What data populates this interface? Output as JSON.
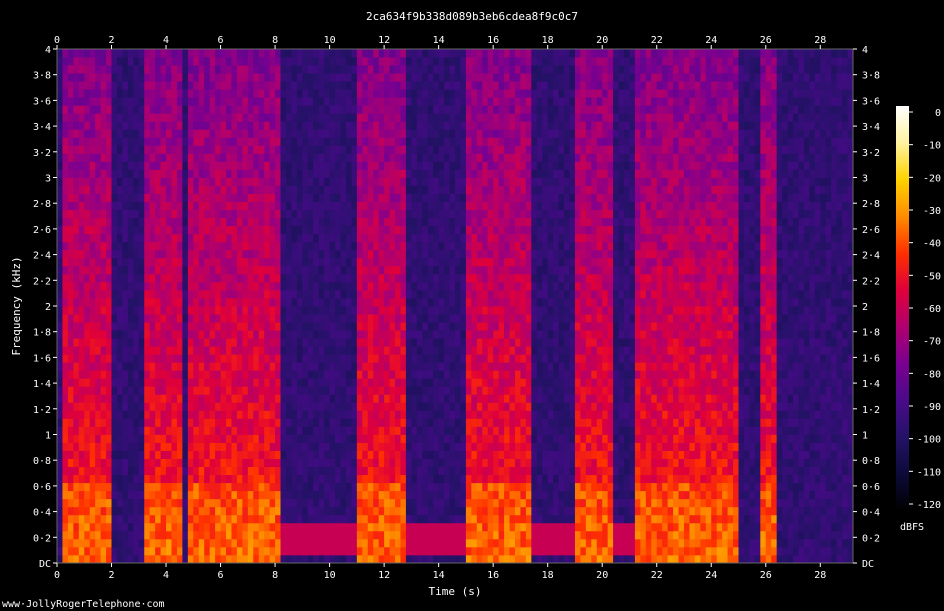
{
  "chart_data": {
    "type": "heatmap",
    "title": "2ca634f9b338d089b3eb6cdea8f9c0c7",
    "xlabel": "Time (s)",
    "ylabel": "Frequency (kHz)",
    "xlim": [
      0,
      29.2
    ],
    "ylim": [
      0,
      4
    ],
    "x_ticks": [
      "0",
      "2",
      "4",
      "6",
      "8",
      "10",
      "12",
      "14",
      "16",
      "18",
      "20",
      "22",
      "24",
      "26",
      "28"
    ],
    "x_tick_values": [
      0,
      2,
      4,
      6,
      8,
      10,
      12,
      14,
      16,
      18,
      20,
      22,
      24,
      26,
      28
    ],
    "y_ticks": [
      "DC",
      "0·2",
      "0·4",
      "0·6",
      "0·8",
      "1",
      "1·2",
      "1·4",
      "1·6",
      "1·8",
      "2",
      "2·2",
      "2·4",
      "2·6",
      "2·8",
      "3",
      "3·2",
      "3·4",
      "3·6",
      "3·8",
      "4"
    ],
    "y_tick_values": [
      0,
      0.2,
      0.4,
      0.6,
      0.8,
      1.0,
      1.2,
      1.4,
      1.6,
      1.8,
      2.0,
      2.2,
      2.4,
      2.6,
      2.8,
      3.0,
      3.2,
      3.4,
      3.6,
      3.8,
      4.0
    ],
    "colorbar": {
      "label": "dBFS",
      "ticks": [
        "0",
        "-10",
        "-20",
        "-30",
        "-40",
        "-50",
        "-60",
        "-70",
        "-80",
        "-90",
        "-100",
        "-110",
        "-120"
      ],
      "tick_values": [
        0,
        -10,
        -20,
        -30,
        -40,
        -50,
        -60,
        -70,
        -80,
        -90,
        -100,
        -110,
        -120
      ],
      "range": [
        -120,
        0
      ],
      "colormap": [
        "#ffffff",
        "#fff3a0",
        "#ffd200",
        "#ff8c00",
        "#ff3000",
        "#e0003a",
        "#b0006e",
        "#7a0090",
        "#4a0a8a",
        "#251268",
        "#0d0a3a",
        "#000000"
      ]
    },
    "speech_segments_s": [
      [
        0.2,
        1.9
      ],
      [
        3.2,
        4.6
      ],
      [
        4.8,
        8.2
      ],
      [
        10.9,
        12.7
      ],
      [
        15.0,
        17.3
      ],
      [
        19.0,
        20.3
      ],
      [
        21.1,
        24.9
      ],
      [
        25.9,
        26.3
      ]
    ],
    "hum_lines_khz": [
      0.08,
      0.17,
      0.25
    ],
    "hum_segments_s": [
      [
        8.2,
        24.9
      ]
    ],
    "background_level_dbfs": -95,
    "speech_peak_dbfs": -40
  },
  "footer": {
    "watermark": "www·JollyRogerTelephone·com"
  }
}
